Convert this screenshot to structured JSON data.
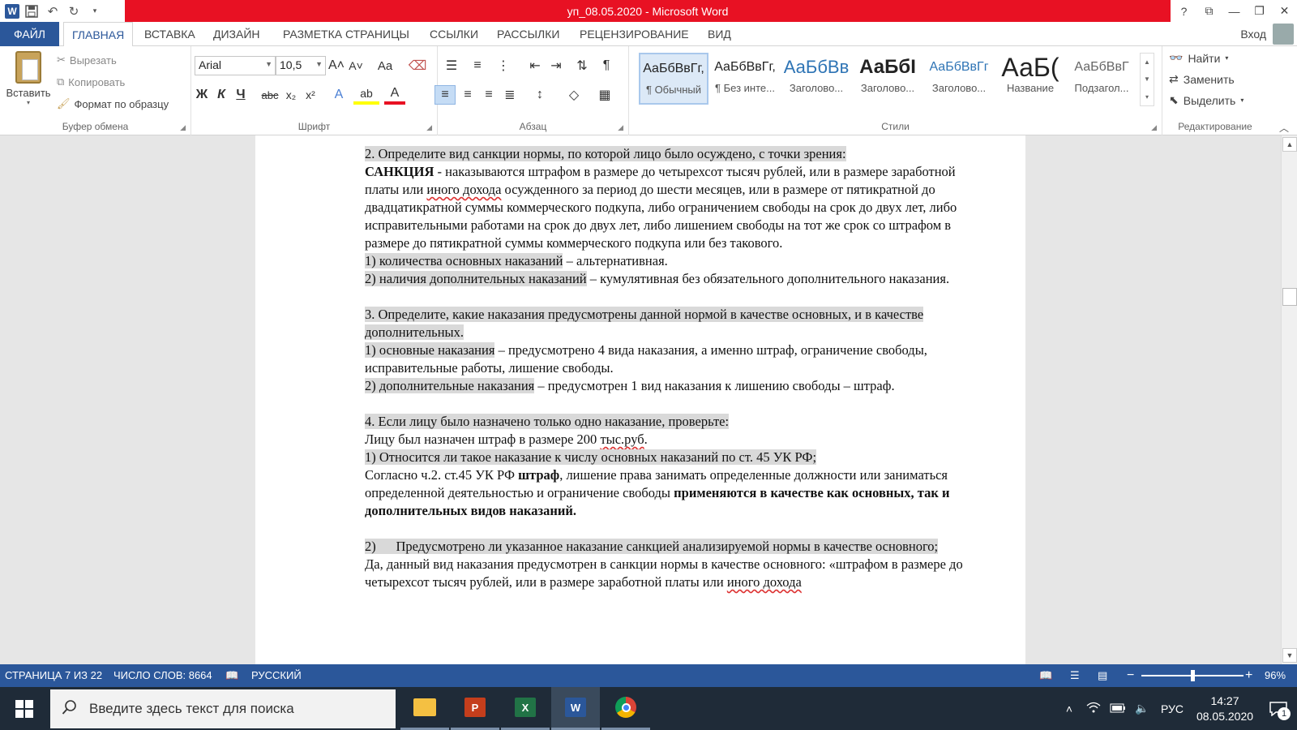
{
  "app": {
    "title": "уп_08.05.2020 -  Microsoft Word",
    "login": "Вход"
  },
  "qat": {
    "word_icon": "W",
    "save_icon": "💾",
    "undo_icon": "↶",
    "redo_icon": "↻"
  },
  "window_controls": {
    "help": "?",
    "restore_ribbon": "⧉",
    "minimize": "—",
    "maximize": "❐",
    "close": "✕"
  },
  "tabs": [
    "ФАЙЛ",
    "ГЛАВНАЯ",
    "ВСТАВКА",
    "ДИЗАЙН",
    "РАЗМЕТКА СТРАНИЦЫ",
    "ССЫЛКИ",
    "РАССЫЛКИ",
    "РЕЦЕНЗИРОВАНИЕ",
    "ВИД"
  ],
  "ribbon": {
    "clipboard": {
      "paste": "Вставить",
      "cut": "Вырезать",
      "copy": "Копировать",
      "format_painter": "Формат по образцу",
      "label": "Буфер обмена"
    },
    "font": {
      "family": "Arial",
      "size": "10,5",
      "label": "Шрифт",
      "bold": "Ж",
      "italic": "К",
      "underline": "Ч",
      "strike": "abc",
      "subscript": "x₂",
      "superscript": "x²",
      "grow": "A˄",
      "shrink": "A˅",
      "case": "Aa",
      "effects": "A",
      "highlight": "ab",
      "color": "A"
    },
    "paragraph": {
      "label": "Абзац"
    },
    "styles": {
      "label": "Стили",
      "items": [
        {
          "preview": "АаБбВвГг,",
          "name": "¶ Обычный"
        },
        {
          "preview": "АаБбВвГг,",
          "name": "¶ Без инте..."
        },
        {
          "preview": "АаБбВв",
          "name": "Заголово..."
        },
        {
          "preview": "АаБбІ",
          "name": "Заголово..."
        },
        {
          "preview": "АаБбВвГг",
          "name": "Заголово..."
        },
        {
          "preview": "АаБ(",
          "name": "Название"
        },
        {
          "preview": "АаБбВвГ",
          "name": "Подзагол..."
        }
      ]
    },
    "editing": {
      "find": "Найти",
      "replace": "Заменить",
      "select": "Выделить",
      "label": "Редактирование"
    }
  },
  "document": {
    "p1": "2. Определите вид санкции нормы, по которой лицо было осуждено, с точки зрения:",
    "p2_bold": "САНКЦИЯ",
    "p2_a": " - наказываются штрафом в размере до четырехсот тысяч рублей, или в размере заработной платы или ",
    "p2_wavy": "иного дохода",
    "p2_b": " осужденного за период до шести месяцев, или в размере от пятикратной до двадцатикратной суммы коммерческого подкупа, либо ограничением свободы на срок до двух лет, либо исправительными работами на срок до двух лет, либо лишением свободы на тот же срок со штрафом в размере до пятикратной суммы коммерческого подкупа или без такового.",
    "p3_hl": "1) количества основных наказаний",
    "p3_rest": " – альтернативная.",
    "p4_hl": "2) наличия дополнительных наказаний",
    "p4_rest": " – кумулятивная без обязательного дополнительного наказания.",
    "p5": "3. Определите, какие наказания предусмотрены данной нормой в качестве основных, и в качестве дополнительных.",
    "p6_hl": "1) основные наказания",
    "p6_rest": " – предусмотрено 4 вида наказания, а именно штраф, ограничение свободы, исправительные работы, лишение свободы.",
    "p7_hl": "2) дополнительные наказания",
    "p7_rest": " – предусмотрен 1 вид наказания к лишению свободы – штраф.",
    "p8": "4. Если лицу было назначено только одно наказание, проверьте:",
    "p9_a": "Лицу был назначен штраф в размере 200 ",
    "p9_wavy": "тыс.руб",
    "p9_b": ".",
    "p10": "1) Относится ли такое наказание к числу основных наказаний по ст. 45 УК РФ;",
    "p11_a": "Согласно ч.2. ст.45 УК РФ ",
    "p11_bold1": "штраф",
    "p11_b": ", лишение права занимать определенные должности или заниматься определенной деятельностью и ограничение свободы ",
    "p11_bold2": "применяются в качестве как основных, так и дополнительных видов наказаний.",
    "p12": "2)      Предусмотрено ли указанное наказание санкцией анализируемой нормы в качестве основного;",
    "p13_a": "Да, данный вид наказания предусмотрен в санкции нормы в качестве основного: «штрафом в размере до четырехсот тысяч рублей, или в размере заработной платы или ",
    "p13_wavy": "иного дохода"
  },
  "statusbar": {
    "page": "СТРАНИЦА 7 ИЗ 22",
    "words": "ЧИСЛО СЛОВ: 8664",
    "language": "РУССКИЙ",
    "zoom_minus": "−",
    "zoom_plus": "+",
    "zoom": "96%",
    "zoom_fraction": 0.5
  },
  "taskbar": {
    "search_placeholder": "Введите здесь текст для поиска",
    "apps": [
      "file-explorer",
      "powerpoint",
      "excel",
      "word",
      "chrome"
    ],
    "powerpoint_label": "P",
    "excel_label": "X",
    "word_label": "W",
    "tray_chevron": "˄",
    "ime": "РУС",
    "time": "14:27",
    "date": "08.05.2020",
    "notifications": "1",
    "colors": {
      "powerpoint": "#c43e1c",
      "excel": "#217346",
      "word": "#2b579a",
      "explorer": "#f4c042"
    }
  }
}
